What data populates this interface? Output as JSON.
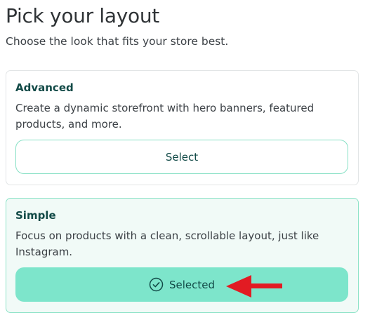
{
  "header": {
    "title": "Pick your layout",
    "subtitle": "Choose the look that fits your store best."
  },
  "layouts": [
    {
      "title": "Advanced",
      "description": "Create a dynamic storefront with hero banners, featured products, and more.",
      "button_label": "Select",
      "selected": false
    },
    {
      "title": "Simple",
      "description": "Focus on products with a clean, scrollable layout, just like Instagram.",
      "button_label": "Selected",
      "selected": true
    }
  ],
  "icons": {
    "selected": "check-circle-icon",
    "annotation": "red-arrow-icon"
  },
  "colors": {
    "accent": "#7de5cb",
    "accent_border": "#86e0c4",
    "selected_card_bg": "#f1faf7",
    "title_text": "#124a47",
    "annotation_arrow": "#e21b23"
  }
}
